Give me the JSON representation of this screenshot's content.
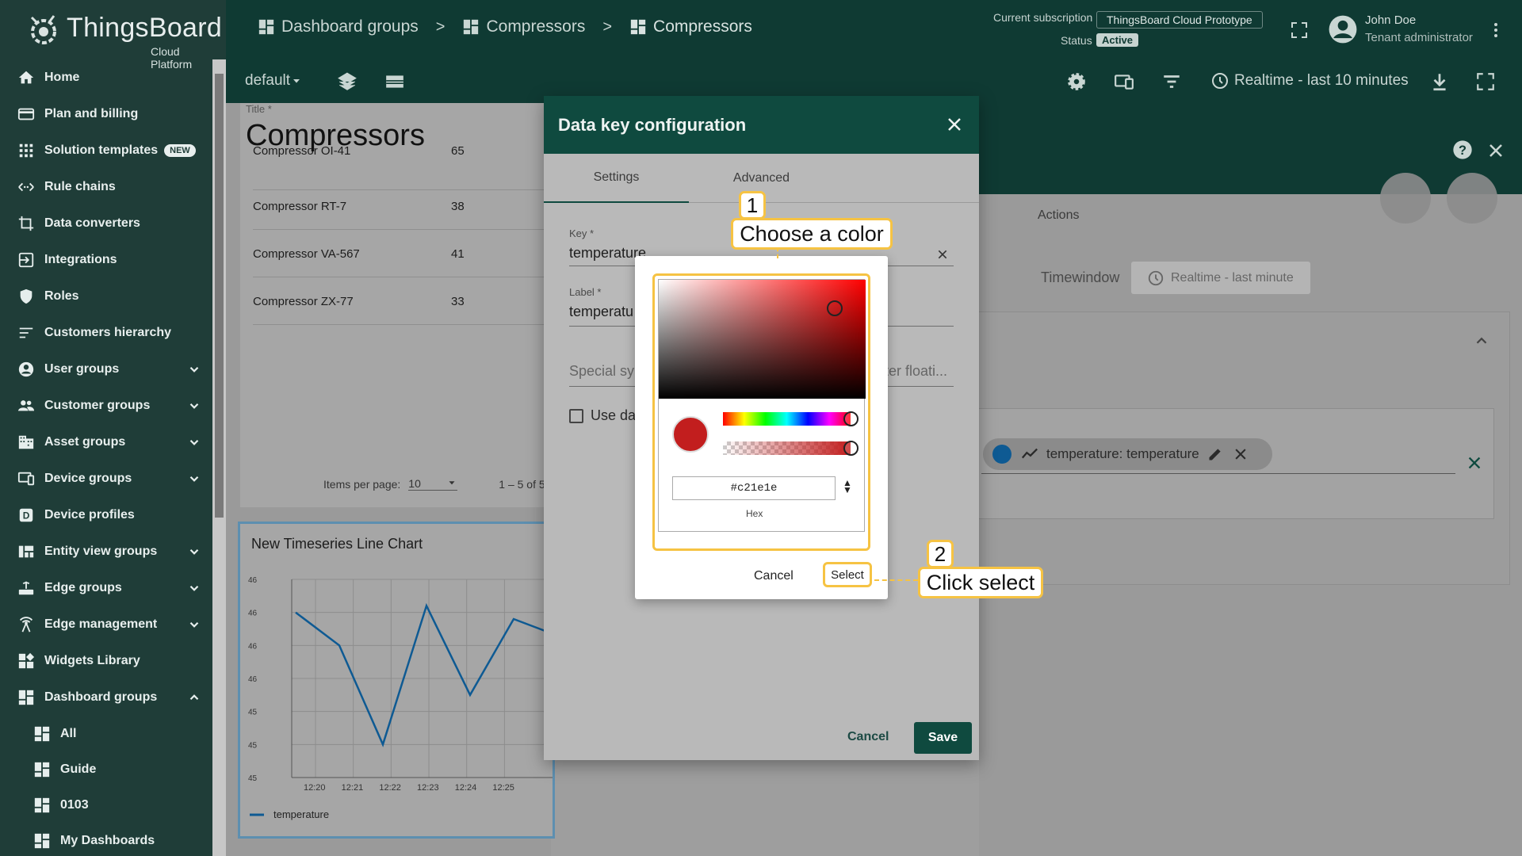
{
  "app": {
    "logo_title": "ThingsBoard",
    "logo_subtitle": "Cloud Platform"
  },
  "sidebar": {
    "items": [
      {
        "label": "Home",
        "icon": "home-icon"
      },
      {
        "label": "Plan and billing",
        "icon": "billing-icon"
      },
      {
        "label": "Solution templates",
        "icon": "apps-grid-icon",
        "badge": "NEW"
      },
      {
        "label": "Rule chains",
        "icon": "rule-chain-icon"
      },
      {
        "label": "Data converters",
        "icon": "converter-icon"
      },
      {
        "label": "Integrations",
        "icon": "integration-icon"
      },
      {
        "label": "Roles",
        "icon": "shield-icon"
      },
      {
        "label": "Customers hierarchy",
        "icon": "hierarchy-icon"
      },
      {
        "label": "User groups",
        "icon": "account-circle-icon",
        "expandable": true
      },
      {
        "label": "Customer groups",
        "icon": "people-icon",
        "expandable": true
      },
      {
        "label": "Asset groups",
        "icon": "domain-icon",
        "expandable": true
      },
      {
        "label": "Device groups",
        "icon": "devices-icon",
        "expandable": true
      },
      {
        "label": "Device profiles",
        "icon": "device-profile-icon"
      },
      {
        "label": "Entity view groups",
        "icon": "view-quilt-icon",
        "expandable": true
      },
      {
        "label": "Edge groups",
        "icon": "router-icon",
        "expandable": true
      },
      {
        "label": "Edge management",
        "icon": "antenna-icon",
        "expandable": true
      },
      {
        "label": "Widgets Library",
        "icon": "widgets-icon"
      },
      {
        "label": "Dashboard groups",
        "icon": "dashboard-icon",
        "expanded": true
      }
    ],
    "sub_items": [
      {
        "label": "All"
      },
      {
        "label": "Guide"
      },
      {
        "label": "0103"
      },
      {
        "label": "My Dashboards"
      }
    ]
  },
  "topbar": {
    "breadcrumbs": [
      "Dashboard groups",
      "Compressors",
      "Compressors"
    ],
    "separator": ">",
    "subscription_label": "Current subscription",
    "subscription_value": "ThingsBoard Cloud Prototype",
    "status_label": "Status",
    "status_value": "Active",
    "user_name": "John Doe",
    "user_role": "Tenant administrator"
  },
  "dash_toolbar": {
    "state": "default",
    "realtime": "Realtime - last 10 minutes"
  },
  "dashboard": {
    "title_label": "Title *",
    "title": "Compressors",
    "rows": [
      {
        "name": "Compressor OI-41",
        "value": "65"
      },
      {
        "name": "Compressor RT-7",
        "value": "38"
      },
      {
        "name": "Compressor VA-567",
        "value": "41"
      },
      {
        "name": "Compressor ZX-77",
        "value": "33"
      }
    ],
    "items_per_page_label": "Items per page:",
    "items_per_page": "10",
    "range": "1 – 5 of 5",
    "chart_title": "New Timeseries Line Chart",
    "chart_legend": "temperature"
  },
  "chart_data": {
    "type": "line",
    "title": "New Timeseries Line Chart",
    "x": [
      "12:20",
      "12:21",
      "12:22",
      "12:23",
      "12:24",
      "12:25"
    ],
    "y_tick_labels": [
      "46",
      "46",
      "46",
      "46",
      "45",
      "45",
      "45"
    ],
    "series": [
      {
        "name": "temperature",
        "color": "#0e5a93",
        "values": [
          45.95,
          45.85,
          45.55,
          45.97,
          45.7,
          45.93,
          45.88
        ]
      }
    ],
    "xlabel": "",
    "ylabel": ""
  },
  "right_panel": {
    "actions_tab": "Actions",
    "timewindow_label": "Timewindow",
    "timewindow_value": "Realtime - last minute",
    "key_chip": "temperature: temperature",
    "key_color": "#0e5a93"
  },
  "dialog": {
    "title": "Data key configuration",
    "tabs": [
      "Settings",
      "Advanced"
    ],
    "key_label": "Key *",
    "key_value": "temperature",
    "label_label": "Label *",
    "label_value": "temperatu",
    "special_symbol_placeholder": "Special sy",
    "decimals_placeholder": "ter floati...",
    "use_checkbox_label": "Use da",
    "cancel": "Cancel",
    "save": "Save"
  },
  "picker": {
    "hex_value": "#c21e1e",
    "hex_label": "Hex",
    "cancel": "Cancel",
    "select": "Select",
    "selected_color": "#c21e1e"
  },
  "callouts": {
    "step1_num": "1",
    "step1_text": "Choose a color",
    "step2_num": "2",
    "step2_text": "Click select"
  }
}
